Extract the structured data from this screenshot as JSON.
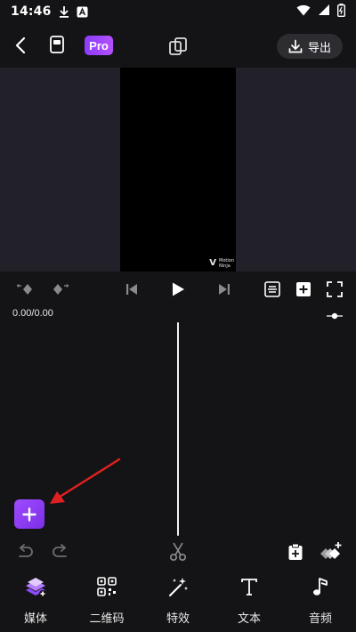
{
  "status_bar": {
    "time": "14:46"
  },
  "top_bar": {
    "pro_label": "Pro",
    "export_label": "导出"
  },
  "preview": {
    "watermark_line1": "Motion",
    "watermark_line2": "Ninja"
  },
  "timeline": {
    "time_readout": "0.00/0.00"
  },
  "bottom_nav": {
    "items": [
      {
        "label": "媒体",
        "icon": "layers-icon"
      },
      {
        "label": "二维码",
        "icon": "qr-code-icon"
      },
      {
        "label": "特效",
        "icon": "magic-wand-icon"
      },
      {
        "label": "文本",
        "icon": "text-icon"
      },
      {
        "label": "音频",
        "icon": "music-note-icon"
      }
    ]
  },
  "colors": {
    "accent": "#9b45ff",
    "background": "#141416",
    "preview_bg": "#222129",
    "annotation_arrow": "#e02020"
  }
}
